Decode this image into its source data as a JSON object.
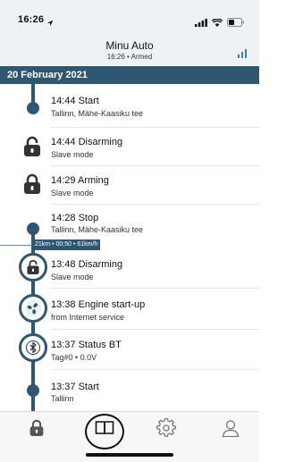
{
  "status_bar": {
    "time": "16:26"
  },
  "header": {
    "title": "Minu Auto",
    "subtitle": "16:26 • Armed"
  },
  "date": "20 February 2021",
  "events": [
    {
      "title": "14:44 Start",
      "subtitle": "Tallinn, Mähe-Kaasiku tee",
      "icon": "dot"
    },
    {
      "title": "14:44 Disarming",
      "subtitle": "Slave mode",
      "icon": "lock-open-icon"
    },
    {
      "title": "14:29 Arming",
      "subtitle": "Slave mode",
      "icon": "lock-icon"
    },
    {
      "title": "14:28 Stop",
      "subtitle": "Tallinn, Mähe-Kaasiku tee",
      "icon": "dot"
    },
    {
      "title": "13:48 Disarming",
      "subtitle": "Slave mode",
      "icon": "lock-open-icon"
    },
    {
      "title": "13:38 Engine start-up",
      "subtitle": "from Internet service",
      "icon": "fan-icon"
    },
    {
      "title": "13:37 Status BT",
      "subtitle": "Tag#0 • 0.0V",
      "icon": "bluetooth-icon"
    },
    {
      "title": "13:37 Start",
      "subtitle": "Tallinn",
      "icon": "dot"
    }
  ],
  "trip_badge": "21km • 00:50 • 61km/h",
  "tabs": [
    {
      "name": "lock-icon"
    },
    {
      "name": "book-icon",
      "selected": true
    },
    {
      "name": "gear-icon"
    },
    {
      "name": "person-icon"
    }
  ],
  "colors": {
    "accent": "#2f5771",
    "header_bg": "#eef2f4",
    "connector": "#4a90c2"
  }
}
